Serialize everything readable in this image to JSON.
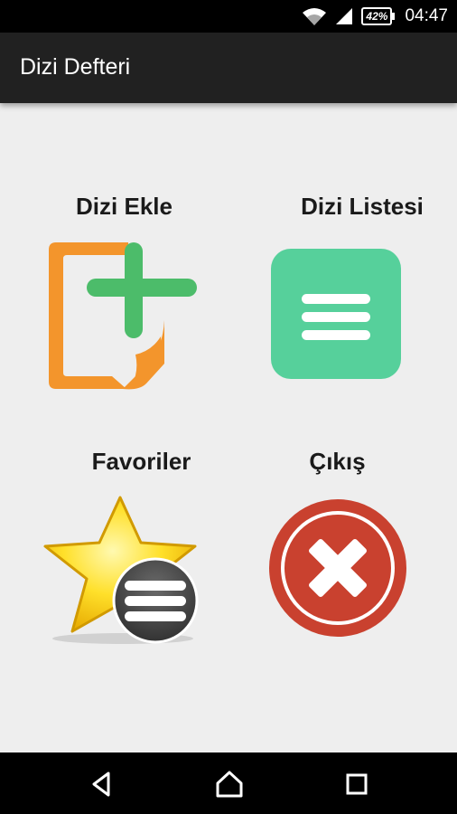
{
  "status_bar": {
    "battery": "42%",
    "time": "04:47",
    "icons": [
      "wifi-icon",
      "signal-icon",
      "battery-icon"
    ]
  },
  "app_bar": {
    "title": "Dizi Defteri"
  },
  "menu": {
    "add_series": {
      "label": "Dizi Ekle",
      "icon": "add-document-icon"
    },
    "series_list": {
      "label": "Dizi Listesi",
      "icon": "list-icon"
    },
    "favorites": {
      "label": "Favoriler",
      "icon": "star-list-icon"
    },
    "exit": {
      "label": "Çıkış",
      "icon": "exit-cross-icon"
    }
  },
  "nav_bar": {
    "icons": [
      "back-icon",
      "home-icon",
      "recents-icon"
    ]
  },
  "colors": {
    "app_bar": "#212121",
    "background": "#eeeeee",
    "orange": "#f3952c",
    "green": "#4cbc6a",
    "teal": "#56d09b",
    "star_yellow": "#ffd51a",
    "exit_red": "#c9412f"
  }
}
